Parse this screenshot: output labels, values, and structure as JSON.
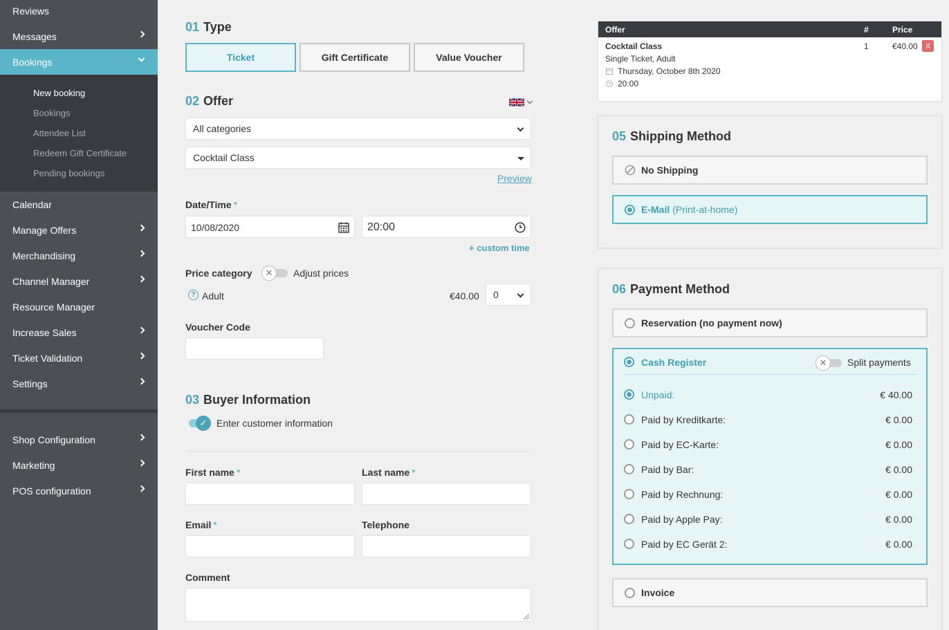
{
  "sidebar": {
    "items_top": [
      {
        "label": "Reviews"
      },
      {
        "label": "Messages"
      },
      {
        "label": "Bookings"
      }
    ],
    "sub_items": [
      {
        "label": "New booking"
      },
      {
        "label": "Bookings"
      },
      {
        "label": "Attendee List"
      },
      {
        "label": "Redeem Gift Certificate"
      },
      {
        "label": "Pending bookings"
      }
    ],
    "items_mid": [
      {
        "label": "Calendar"
      },
      {
        "label": "Manage Offers"
      },
      {
        "label": "Merchandising"
      },
      {
        "label": "Channel Manager"
      },
      {
        "label": "Resource Manager"
      },
      {
        "label": "Increase Sales"
      },
      {
        "label": "Ticket Validation"
      },
      {
        "label": "Settings"
      }
    ],
    "items_bottom": [
      {
        "label": "Shop Configuration"
      },
      {
        "label": "Marketing"
      },
      {
        "label": "POS configuration"
      }
    ]
  },
  "type_section": {
    "num": "01",
    "title": "Type",
    "buttons": [
      "Ticket",
      "Gift Certificate",
      "Value Voucher"
    ]
  },
  "offer_section": {
    "num": "02",
    "title": "Offer",
    "category_select": "All categories",
    "offer_select": "Cocktail Class",
    "preview_link": "Preview",
    "datetime_label": "Date/Time",
    "required_mark": "*",
    "date_value": "10/08/2020",
    "time_value": "20:00",
    "custom_time_link": "+ custom time",
    "price_category_label": "Price category",
    "adjust_prices_label": "Adjust prices",
    "price_row": {
      "name": "Adult",
      "price": "€40.00",
      "qty": "0"
    },
    "voucher_label": "Voucher Code"
  },
  "buyer_section": {
    "num": "03",
    "title": "Buyer Information",
    "toggle_label": "Enter customer information",
    "first_name": "First name",
    "last_name": "Last name",
    "email": "Email",
    "telephone": "Telephone",
    "comment": "Comment"
  },
  "cart": {
    "headers": [
      "Offer",
      "#",
      "Price"
    ],
    "item": {
      "name": "Cocktail Class",
      "desc": "Single Ticket, Adult",
      "date": "Thursday, October 8th 2020",
      "time": "20:00",
      "qty": "1",
      "price": "€40.00",
      "remove": "X"
    }
  },
  "shipping_section": {
    "num": "05",
    "title": "Shipping Method",
    "options": [
      {
        "label": "No Shipping",
        "extra": ""
      },
      {
        "label": "E-Mail",
        "extra": "(Print-at-home)"
      }
    ]
  },
  "payment_section": {
    "num": "06",
    "title": "Payment Method",
    "reservation": "Reservation (no payment now)",
    "cash_register": "Cash Register",
    "split_payments": "Split payments",
    "rows": [
      {
        "label": "Unpaid:",
        "amount": "€ 40.00"
      },
      {
        "label": "Paid by Kreditkarte:",
        "amount": "€ 0.00"
      },
      {
        "label": "Paid by EC-Karte:",
        "amount": "€ 0.00"
      },
      {
        "label": "Paid by Bar:",
        "amount": "€ 0.00"
      },
      {
        "label": "Paid by Rechnung:",
        "amount": "€ 0.00"
      },
      {
        "label": "Paid by Apple Pay:",
        "amount": "€ 0.00"
      },
      {
        "label": "Paid by EC Gerät 2:",
        "amount": "€ 0.00"
      }
    ],
    "invoice": "Invoice"
  },
  "colors": {
    "accent": "#4aa3b8",
    "sidebar_bg": "#4d4f55",
    "active_nav": "#5bb5c8",
    "remove": "#e06a6a"
  },
  "icons": [
    "chevron-right-icon",
    "chevron-down-icon",
    "uk-flag-icon",
    "calendar-icon",
    "clock-icon",
    "help-icon",
    "check-icon",
    "ban-icon"
  ]
}
